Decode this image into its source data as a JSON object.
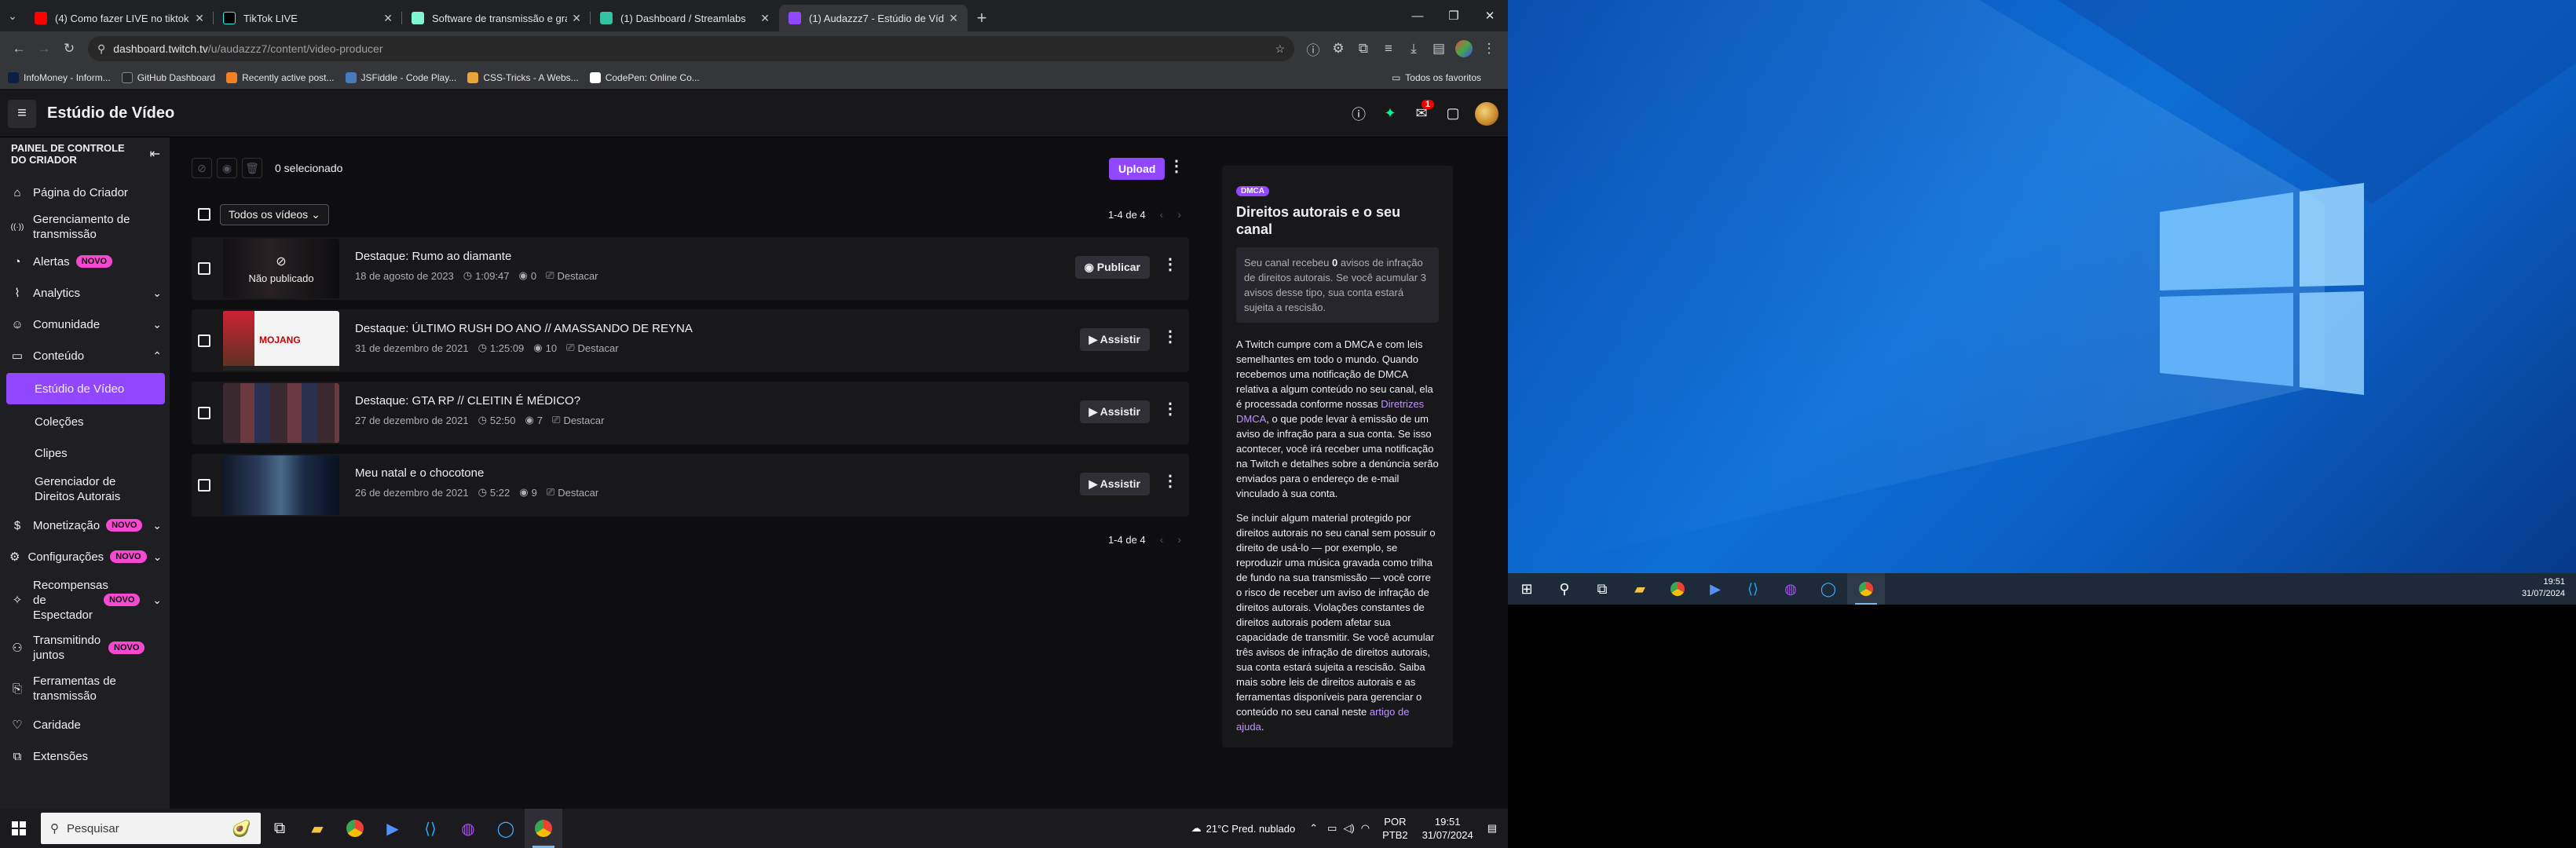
{
  "browser": {
    "tabs": [
      {
        "title": "(4) Como fazer LIVE no tiktok p",
        "color": "#ff0000"
      },
      {
        "title": "TikTok LIVE",
        "color": "#000000"
      },
      {
        "title": "Software de transmissão e gra",
        "color": "#80f5d2"
      },
      {
        "title": "(1) Dashboard / Streamlabs",
        "color": "#31c3a2"
      },
      {
        "title": "(1) Audazzz7 - Estúdio de Víde",
        "color": "#9147ff"
      }
    ],
    "url_domain": "dashboard.twitch.tv",
    "url_path": "/u/audazzz7/content/video-producer",
    "bookmarks": [
      "InfoMoney - Inform...",
      "GitHub Dashboard",
      "Recently active post...",
      "JSFiddle - Code Play...",
      "CSS-Tricks - A Webs...",
      "CodePen: Online Co..."
    ],
    "bookmarks_right": "Todos os favoritos"
  },
  "app": {
    "title": "Estúdio de Vídeo",
    "notif_count": "1"
  },
  "sidebar": {
    "heading": "Painel de controle do criador",
    "items": [
      {
        "label": "Página do Criador",
        "icon": "⌂"
      },
      {
        "label": "Gerenciamento de transmissão",
        "icon": "((·))"
      },
      {
        "label": "Alertas",
        "icon": "◔",
        "badge": "NOVO"
      },
      {
        "label": "Analytics",
        "icon": "⌇"
      },
      {
        "label": "Comunidade",
        "icon": "☺"
      },
      {
        "label": "Conteúdo",
        "icon": "▭"
      }
    ],
    "content_sub": [
      "Estúdio de Vídeo",
      "Coleções",
      "Clipes",
      "Gerenciador de Direitos Autorais"
    ],
    "items2": [
      {
        "label": "Monetização",
        "icon": "$",
        "badge": "NOVO"
      },
      {
        "label": "Configurações",
        "icon": "⚙",
        "badge": "NOVO"
      },
      {
        "label": "Recompensas de Espectador",
        "icon": "✧",
        "badge": "NOVO"
      },
      {
        "label": "Transmitindo juntos",
        "icon": "⚇",
        "badge": "NOVO"
      },
      {
        "label": "Ferramentas de transmissão",
        "icon": "⎘"
      },
      {
        "label": "Caridade",
        "icon": "♡"
      },
      {
        "label": "Extensões",
        "icon": "⧉"
      }
    ]
  },
  "main": {
    "selected": "0 selecionado",
    "upload": "Upload",
    "filter": "Todos os vídeos",
    "pager": "1-4 de 4",
    "videos": [
      {
        "title": "Destaque: Rumo ao diamante",
        "date": "18 de agosto de 2023",
        "duration": "1:09:47",
        "views": "0",
        "tag": "Destacar",
        "button": "Publicar",
        "overlay": "Não publicado"
      },
      {
        "title": "Destaque: ÚLTIMO RUSH DO ANO // AMASSANDO DE REYNA",
        "date": "31 de dezembro de 2021",
        "duration": "1:25:09",
        "views": "10",
        "tag": "Destacar",
        "button": "Assistir",
        "overlay": ""
      },
      {
        "title": "Destaque: GTA RP // CLEITIN É MÉDICO?",
        "date": "27 de dezembro de 2021",
        "duration": "52:50",
        "views": "7",
        "tag": "Destacar",
        "button": "Assistir",
        "overlay": ""
      },
      {
        "title": "Meu natal e o chocotone",
        "date": "26 de dezembro de 2021",
        "duration": "5:22",
        "views": "9",
        "tag": "Destacar",
        "button": "Assistir",
        "overlay": ""
      }
    ]
  },
  "dmca": {
    "tag": "DMCA",
    "title": "Direitos autorais e o seu canal",
    "box_pre": "Seu canal recebeu",
    "box_count": "0",
    "box_post": "avisos de infração de direitos autorais. Se você acumular 3 avisos desse tipo, sua conta estará sujeita a rescisão.",
    "p1_pre": "A Twitch cumpre com a DMCA e com leis semelhantes em todo o mundo. Quando recebemos uma notificação de DMCA relativa a algum conteúdo no seu canal, ela é processada conforme nossas",
    "p1_link": "Diretrizes DMCA",
    "p1_post": ", o que pode levar à emissão de um aviso de infração para a sua conta. Se isso acontecer, você irá receber uma notificação na Twitch e detalhes sobre a denúncia serão enviados para o endereço de e-mail vinculado à sua conta.",
    "p2_pre": "Se incluir algum material protegido por direitos autorais no seu canal sem possuir o direito de usá-lo — por exemplo, se reproduzir uma música gravada como trilha de fundo na sua transmissão — você corre o risco de receber um aviso de infração de direitos autorais. Violações constantes de direitos autorais podem afetar sua capacidade de transmitir. Se você acumular três avisos de infração de direitos autorais, sua conta estará sujeita a rescisão. Saiba mais sobre leis de direitos autorais e as ferramentas disponíveis para gerenciar o conteúdo no seu canal neste",
    "p2_link": "artigo de ajuda",
    "p2_post": "."
  },
  "taskbar": {
    "search": "Pesquisar",
    "weather": "21°C  Pred. nublado",
    "lang1": "POR",
    "lang2": "PTB2",
    "time": "19:51",
    "date": "31/07/2024"
  },
  "desktop2": {
    "time": "19:51",
    "date": "31/07/2024"
  }
}
